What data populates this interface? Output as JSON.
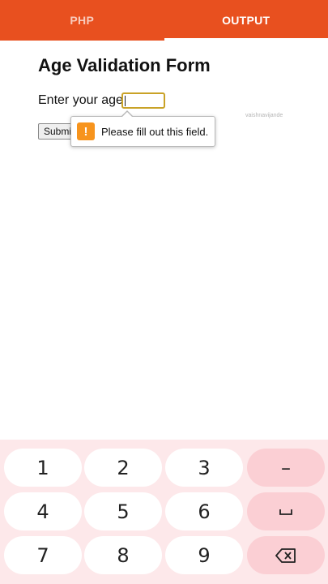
{
  "tabs": [
    {
      "label": "PHP",
      "active": false
    },
    {
      "label": "OUTPUT",
      "active": true
    }
  ],
  "form": {
    "title": "Age Validation Form",
    "age_label": "Enter your age:",
    "age_value": "",
    "submit_label": "Submit"
  },
  "watermark": "vaishnavijande",
  "validation": {
    "icon": "warning-icon",
    "icon_glyph": "!",
    "message": "Please fill out this field."
  },
  "keyboard": {
    "rows": [
      [
        {
          "label": "1"
        },
        {
          "label": "2"
        },
        {
          "label": "3"
        },
        {
          "label": "–",
          "fn": true
        }
      ],
      [
        {
          "label": "4"
        },
        {
          "label": "5"
        },
        {
          "label": "6"
        },
        {
          "label": "␣",
          "fn": true,
          "icon": "space-icon"
        }
      ],
      [
        {
          "label": "7"
        },
        {
          "label": "8"
        },
        {
          "label": "9"
        },
        {
          "label": "",
          "fn": true,
          "icon": "backspace-icon"
        }
      ]
    ]
  },
  "colors": {
    "accent": "#e8501f",
    "keyboard_bg": "#fde8ea",
    "fn_key": "#fbcfd4",
    "warning": "#f7941d",
    "input_border": "#c9a227"
  }
}
